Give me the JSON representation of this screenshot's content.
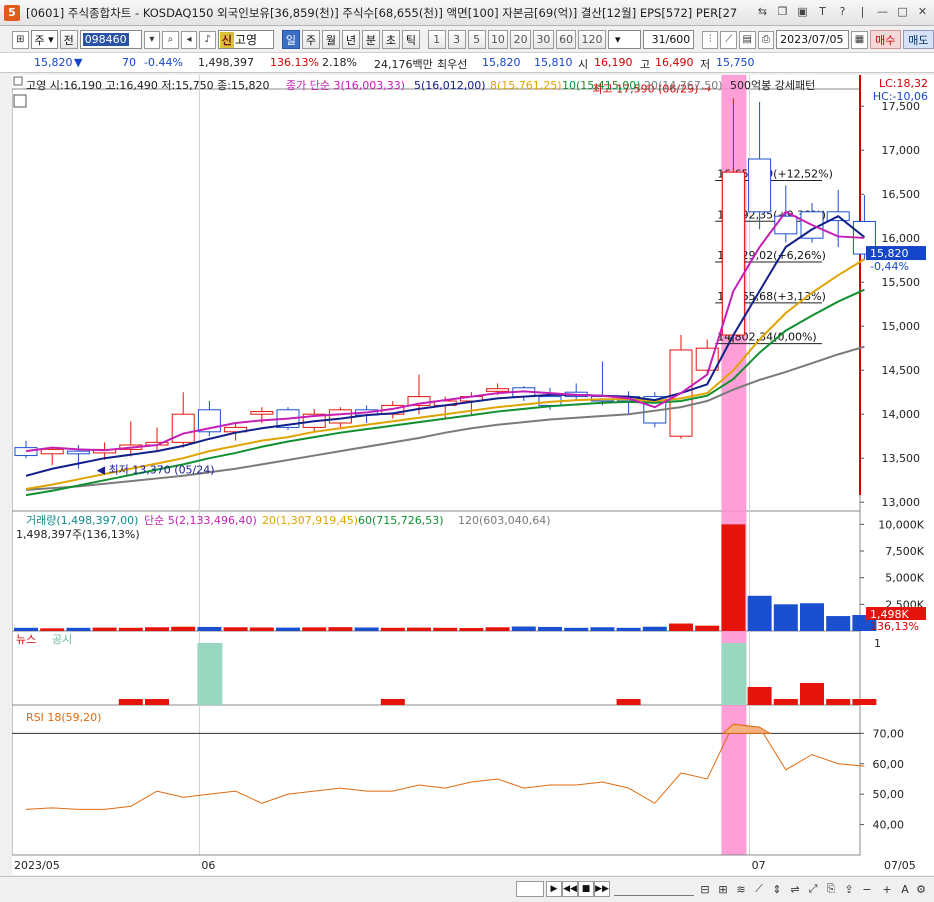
{
  "window": {
    "badge": "5",
    "title": "[0601] 주식종합차트 - KOSDAQ150 외국인보유[36,859(천)] 주식수[68,655(천)] 액면[100] 자본금[69(억)] 결산[12월] EPS[572] PER[27"
  },
  "toolbar": {
    "type_select": "주",
    "prev_label": "전",
    "code": "098460",
    "shin": "신",
    "name": "고영",
    "periods": [
      "일",
      "주",
      "월",
      "년",
      "분",
      "초",
      "틱"
    ],
    "active_period": "일",
    "nums": [
      "1",
      "3",
      "5",
      "10",
      "20",
      "30",
      "60",
      "120"
    ],
    "count": "31/600",
    "date": "2023/07/05",
    "buy_label": "매수",
    "sell_label": "매도"
  },
  "info": {
    "price": "15,820",
    "arrow": "▼",
    "change": "70",
    "pct": "-0.44%",
    "volume": "1,498,397",
    "vol_ratio": "136.13%",
    "turnover": "2.18%",
    "amount": "24,176백만",
    "best_label": "최우선",
    "bid1": "15,820",
    "bid2": "15,810",
    "open_label": "시",
    "open": "16,190",
    "high_label": "고",
    "high": "16,490",
    "low_label": "저",
    "low": "15,750"
  },
  "chart_data": {
    "type": "candlestick",
    "title": "고영 시:16,190 고:16,490 저:15,750 종:15,820",
    "ma_legend": [
      "종가 단순 3(16,003,33)",
      "5(16,012,00)",
      "8(15,761,25)",
      "10(15,415,00)",
      "20(14,767,50)"
    ],
    "pattern_legend": "500억봉 강세패턴",
    "lc_label": "LC:18,32",
    "hc_label": "HC:-10,06",
    "current_price_label": "15,820",
    "current_pct_label": "-0,44%",
    "ylim": [
      12900,
      17650
    ],
    "yticks": [
      "17,500",
      "17,000",
      "16,500",
      "16,000",
      "15,500",
      "15,000",
      "14,500",
      "14,000",
      "13,500",
      "13,000"
    ],
    "ytick_values": [
      17500,
      17000,
      16500,
      16000,
      15500,
      15000,
      14500,
      14000,
      13500,
      13000
    ],
    "high_annotation": "최고 17,590 (06/29)",
    "low_annotation": "최저 13,370 (05/24)",
    "fib_levels": [
      {
        "value": 16655.69,
        "label": "16,655,69(+12,52%)"
      },
      {
        "value": 16192.35,
        "label": "16,192,35(+9,39%)"
      },
      {
        "value": 15729.02,
        "label": "15,729,02(+6,26%)"
      },
      {
        "value": 15265.68,
        "label": "15,265,68(+3,13%)"
      },
      {
        "value": 14802.34,
        "label": "14,802,34(0,00%)"
      }
    ],
    "candles": [
      {
        "o": 13620,
        "h": 13700,
        "l": 13500,
        "c": 13530
      },
      {
        "o": 13550,
        "h": 13620,
        "l": 13420,
        "c": 13600
      },
      {
        "o": 13580,
        "h": 13650,
        "l": 13380,
        "c": 13550
      },
      {
        "o": 13560,
        "h": 13680,
        "l": 13480,
        "c": 13600
      },
      {
        "o": 13600,
        "h": 13920,
        "l": 13520,
        "c": 13650
      },
      {
        "o": 13650,
        "h": 13850,
        "l": 13570,
        "c": 13680
      },
      {
        "o": 13680,
        "h": 14250,
        "l": 13620,
        "c": 14000
      },
      {
        "o": 14050,
        "h": 14150,
        "l": 13750,
        "c": 13800
      },
      {
        "o": 13800,
        "h": 13900,
        "l": 13700,
        "c": 13850
      },
      {
        "o": 14000,
        "h": 14080,
        "l": 13900,
        "c": 14030
      },
      {
        "o": 14050,
        "h": 14080,
        "l": 13820,
        "c": 13850
      },
      {
        "o": 13850,
        "h": 14060,
        "l": 13800,
        "c": 14000
      },
      {
        "o": 13900,
        "h": 14080,
        "l": 13850,
        "c": 14050
      },
      {
        "o": 14050,
        "h": 14100,
        "l": 13900,
        "c": 13990
      },
      {
        "o": 14000,
        "h": 14150,
        "l": 13950,
        "c": 14100
      },
      {
        "o": 14100,
        "h": 14450,
        "l": 14000,
        "c": 14200
      },
      {
        "o": 14100,
        "h": 14200,
        "l": 13950,
        "c": 14150
      },
      {
        "o": 14150,
        "h": 14250,
        "l": 14000,
        "c": 14200
      },
      {
        "o": 14260,
        "h": 14350,
        "l": 14220,
        "c": 14290
      },
      {
        "o": 14300,
        "h": 14320,
        "l": 14150,
        "c": 14200
      },
      {
        "o": 14200,
        "h": 14300,
        "l": 14050,
        "c": 14100
      },
      {
        "o": 14250,
        "h": 14350,
        "l": 14150,
        "c": 14200
      },
      {
        "o": 14200,
        "h": 14600,
        "l": 14100,
        "c": 14150
      },
      {
        "o": 14200,
        "h": 14260,
        "l": 14000,
        "c": 14150
      },
      {
        "o": 14200,
        "h": 14250,
        "l": 13850,
        "c": 13900
      },
      {
        "o": 13750,
        "h": 14900,
        "l": 13720,
        "c": 14730
      },
      {
        "o": 14500,
        "h": 14850,
        "l": 14450,
        "c": 14750
      },
      {
        "o": 14900,
        "h": 17590,
        "l": 14800,
        "c": 16750
      },
      {
        "o": 16900,
        "h": 17550,
        "l": 16100,
        "c": 16300
      },
      {
        "o": 16250,
        "h": 16600,
        "l": 15950,
        "c": 16050
      },
      {
        "o": 16300,
        "h": 16400,
        "l": 15950,
        "c": 16000
      },
      {
        "o": 16300,
        "h": 16550,
        "l": 15900,
        "c": 16200
      },
      {
        "o": 16190,
        "h": 16490,
        "l": 15750,
        "c": 15820
      }
    ],
    "ma3": [
      13580,
      13620,
      13600,
      13590,
      13620,
      13650,
      13780,
      13840,
      13900,
      13930,
      13950,
      13980,
      14000,
      14020,
      14060,
      14120,
      14160,
      14200,
      14240,
      14260,
      14240,
      14220,
      14210,
      14180,
      14080,
      14240,
      14450,
      15400,
      15900,
      16300,
      16150,
      16020,
      16003
    ],
    "ma5": [
      13300,
      13380,
      13440,
      13500,
      13540,
      13580,
      13640,
      13720,
      13790,
      13840,
      13880,
      13920,
      13950,
      13990,
      14010,
      14060,
      14100,
      14140,
      14180,
      14200,
      14220,
      14220,
      14210,
      14200,
      14160,
      14240,
      14340,
      14900,
      15400,
      15900,
      16100,
      16250,
      16012
    ],
    "ma8": [
      13150,
      13200,
      13260,
      13320,
      13380,
      13440,
      13500,
      13580,
      13640,
      13700,
      13740,
      13800,
      13840,
      13880,
      13920,
      13960,
      14000,
      14040,
      14080,
      14110,
      14140,
      14160,
      14170,
      14170,
      14150,
      14180,
      14240,
      14500,
      14850,
      15150,
      15380,
      15580,
      15761
    ],
    "ma10": [
      13080,
      13130,
      13190,
      13250,
      13310,
      13370,
      13430,
      13500,
      13560,
      13630,
      13690,
      13740,
      13790,
      13830,
      13870,
      13910,
      13950,
      13990,
      14030,
      14060,
      14090,
      14110,
      14130,
      14140,
      14130,
      14150,
      14210,
      14400,
      14700,
      14950,
      15120,
      15280,
      15415
    ],
    "ma20": [
      13140,
      13160,
      13180,
      13210,
      13240,
      13270,
      13300,
      13340,
      13380,
      13430,
      13480,
      13530,
      13580,
      13630,
      13680,
      13730,
      13790,
      13840,
      13880,
      13910,
      13940,
      13960,
      13980,
      14000,
      14040,
      14080,
      14150,
      14280,
      14390,
      14480,
      14580,
      14680,
      14767
    ],
    "volume": {
      "title": "거래량(1,498,397,00)",
      "ma_legend": [
        "단순 5(2,133,496,40)",
        "20(1,307,919,45)",
        "60(715,726,53)",
        "120(603,040,64)"
      ],
      "sub": "1,498,397주(136,13%)",
      "yticks": [
        "10,000K",
        "7,500K",
        "5,000K",
        "2,500K"
      ],
      "ytick_values": [
        10000,
        7500,
        5000,
        2500
      ],
      "current_label": "1,498K",
      "current_pct": "136,13%",
      "values": [
        300,
        250,
        300,
        320,
        300,
        350,
        400,
        380,
        350,
        330,
        320,
        340,
        360,
        330,
        300,
        320,
        300,
        280,
        350,
        420,
        380,
        300,
        350,
        300,
        400,
        700,
        500,
        10000,
        3300,
        2500,
        2600,
        1400,
        1498
      ]
    },
    "news": {
      "label_news": "뉴스",
      "label_notice": "공시",
      "ytick": "1"
    },
    "rsi": {
      "title": "RSI 18(59,20)",
      "yticks": [
        "70,00",
        "60,00",
        "50,00",
        "40,00"
      ],
      "ytick_values": [
        70,
        60,
        50,
        40
      ],
      "values": [
        45,
        45.5,
        45,
        45,
        46,
        51,
        49,
        50,
        51,
        47,
        50,
        51,
        52,
        51,
        51,
        53,
        52,
        54,
        55,
        52,
        53,
        53,
        54,
        52,
        47,
        57,
        55,
        73,
        72,
        58,
        63,
        60,
        59.2
      ]
    },
    "xlabels": [
      {
        "label": "2023/05",
        "idx": 0
      },
      {
        "label": "06",
        "idx": 7
      },
      {
        "label": "07",
        "idx": 28
      }
    ],
    "xlabel_right": "07/05"
  },
  "colors": {
    "up": "#e5140a",
    "down": "#1a4fd0",
    "ma3": "#c51fb5",
    "ma5": "#10208a",
    "ma8": "#e0a400",
    "ma10": "#109030",
    "ma20": "#7a7a7a",
    "highlight": "#ff8ed0",
    "notice": "#98d8c0",
    "rsi": "#e06a10"
  }
}
